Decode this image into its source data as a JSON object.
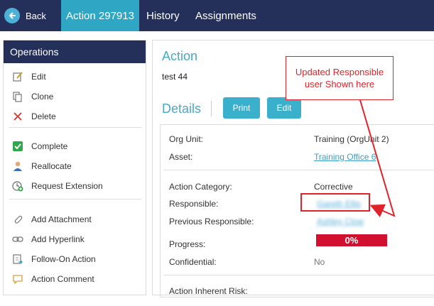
{
  "nav": {
    "back_label": "Back",
    "tabs": [
      {
        "label": "Action 297913",
        "active": true
      },
      {
        "label": "History",
        "active": false
      },
      {
        "label": "Assignments",
        "active": false
      }
    ]
  },
  "sidebar": {
    "title": "Operations",
    "items": [
      {
        "label": "Edit",
        "icon": "edit-icon"
      },
      {
        "label": "Clone",
        "icon": "clone-icon"
      },
      {
        "label": "Delete",
        "icon": "delete-icon"
      },
      {
        "label": "Complete",
        "icon": "check-icon"
      },
      {
        "label": "Reallocate",
        "icon": "user-icon"
      },
      {
        "label": "Request Extension",
        "icon": "clock-plus-icon"
      },
      {
        "label": "Add Attachment",
        "icon": "paperclip-icon"
      },
      {
        "label": "Add Hyperlink",
        "icon": "hyperlink-icon"
      },
      {
        "label": "Follow-On Action",
        "icon": "follow-on-icon"
      },
      {
        "label": "Action Comment",
        "icon": "comment-icon"
      }
    ]
  },
  "main": {
    "action_heading": "Action",
    "action_description": "test 44",
    "details_heading": "Details",
    "print_label": "Print",
    "edit_label": "Edit",
    "fields": {
      "org_unit_label": "Org Unit:",
      "org_unit_value": "Training (OrgUnit 2)",
      "asset_label": "Asset:",
      "asset_value": "Training Office 6",
      "category_label": "Action Category:",
      "category_value": "Corrective",
      "responsible_label": "Responsible:",
      "responsible_value": "Gareth Ellis",
      "prev_responsible_label": "Previous Responsible:",
      "prev_responsible_value": "Ashley Clow",
      "progress_label": "Progress:",
      "progress_value": "0%",
      "progress_fraction": 0,
      "confidential_label": "Confidential:",
      "confidential_value": "No",
      "inherent_risk_label": "Action Inherent Risk:"
    }
  },
  "annotation": {
    "callout_text": "Updated Responsible user Shown here"
  },
  "colors": {
    "navy": "#243059",
    "teal": "#2fa6c4",
    "accent_text": "#48a9c5",
    "progress_red": "#d0102e",
    "annotation_red": "#e0232a"
  }
}
